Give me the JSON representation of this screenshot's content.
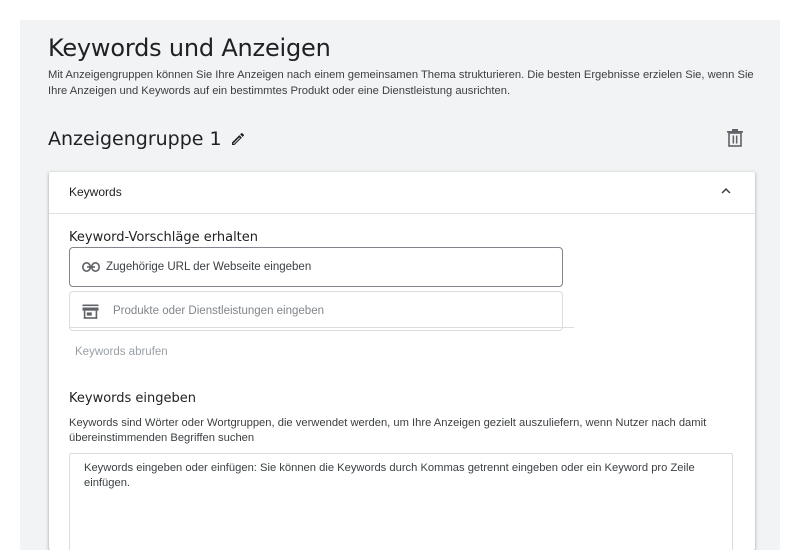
{
  "header": {
    "title": "Keywords und Anzeigen",
    "description": "Mit Anzeigengruppen können Sie Ihre Anzeigen nach einem gemeinsamen Thema strukturieren. Die besten Ergebnisse erzielen Sie, wenn Sie Ihre Anzeigen und Keywords auf ein bestimmtes Produkt oder eine Dienstleistung ausrichten."
  },
  "ad_group": {
    "title": "Anzeigengruppe 1",
    "edit_icon": "pencil-icon",
    "delete_icon": "trash-icon"
  },
  "keywords_card": {
    "header_label": "Keywords",
    "collapse_icon": "chevron-up-icon",
    "suggestions_label": "Keyword-Vorschläge erhalten",
    "url_placeholder": "Zugehörige URL der Webseite eingeben",
    "url_icon": "link-icon",
    "products_placeholder": "Produkte oder Dienstleistungen eingeben",
    "products_icon": "store-icon",
    "fetch_button": "Keywords abrufen",
    "enter_label": "Keywords eingeben",
    "enter_help": "Keywords sind Wörter oder Wortgruppen, die verwendet werden, um Ihre Anzeigen gezielt auszuliefern, wenn Nutzer nach damit übereinstimmenden Begriffen suchen",
    "textarea_placeholder": "Keywords eingeben oder einfügen: Sie können die Keywords durch Kommas getrennt eingeben oder ein Keyword pro Zeile einfügen."
  },
  "colors": {
    "page_background": "#f1f3f4",
    "text": "#202124",
    "muted": "#80868b"
  }
}
